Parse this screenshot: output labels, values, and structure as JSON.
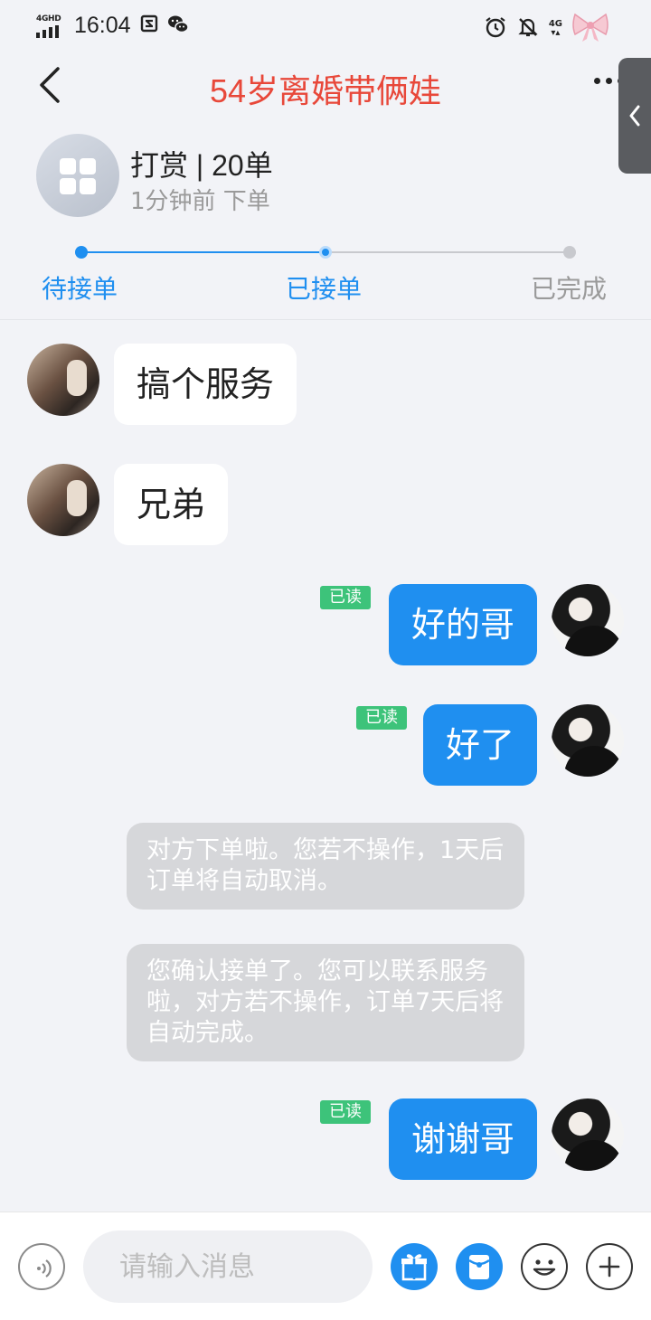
{
  "status_bar": {
    "network": "4GHD",
    "time": "16:04",
    "icons": [
      "sim-icon",
      "wechat-icon",
      "alarm-icon",
      "bell-muted-icon",
      "4g-icon",
      "bow-icon"
    ],
    "right_net": "4G"
  },
  "header": {
    "title": "54岁离婚带俩娃"
  },
  "order": {
    "title": "打赏 | 20单",
    "subtitle": "1分钟前  下单"
  },
  "progress": {
    "steps": [
      {
        "label": "待接单",
        "state": "done"
      },
      {
        "label": "已接单",
        "state": "current"
      },
      {
        "label": "已完成",
        "state": "pending"
      }
    ],
    "active_color": "#1f8ff0",
    "inactive_color": "#c8c9ce"
  },
  "messages": [
    {
      "side": "in",
      "text": "搞个服务"
    },
    {
      "side": "in",
      "text": "兄弟"
    },
    {
      "side": "out",
      "text": "好的哥",
      "read": "已读"
    },
    {
      "side": "out",
      "text": "好了",
      "read": "已读"
    },
    {
      "side": "system",
      "text": "对方下单啦。您若不操作，1天后订单将自动取消。"
    },
    {
      "side": "system",
      "text": "您确认接单了。您可以联系服务啦，对方若不操作，订单7天后将自动完成。"
    },
    {
      "side": "out",
      "text": "谢谢哥",
      "read": "已读"
    }
  ],
  "input_bar": {
    "placeholder": "请输入消息"
  },
  "colors": {
    "title": "#e8483a",
    "accent": "#1f8ff0",
    "read_badge": "#3dc37a",
    "system_bubble": "#d6d7da"
  }
}
